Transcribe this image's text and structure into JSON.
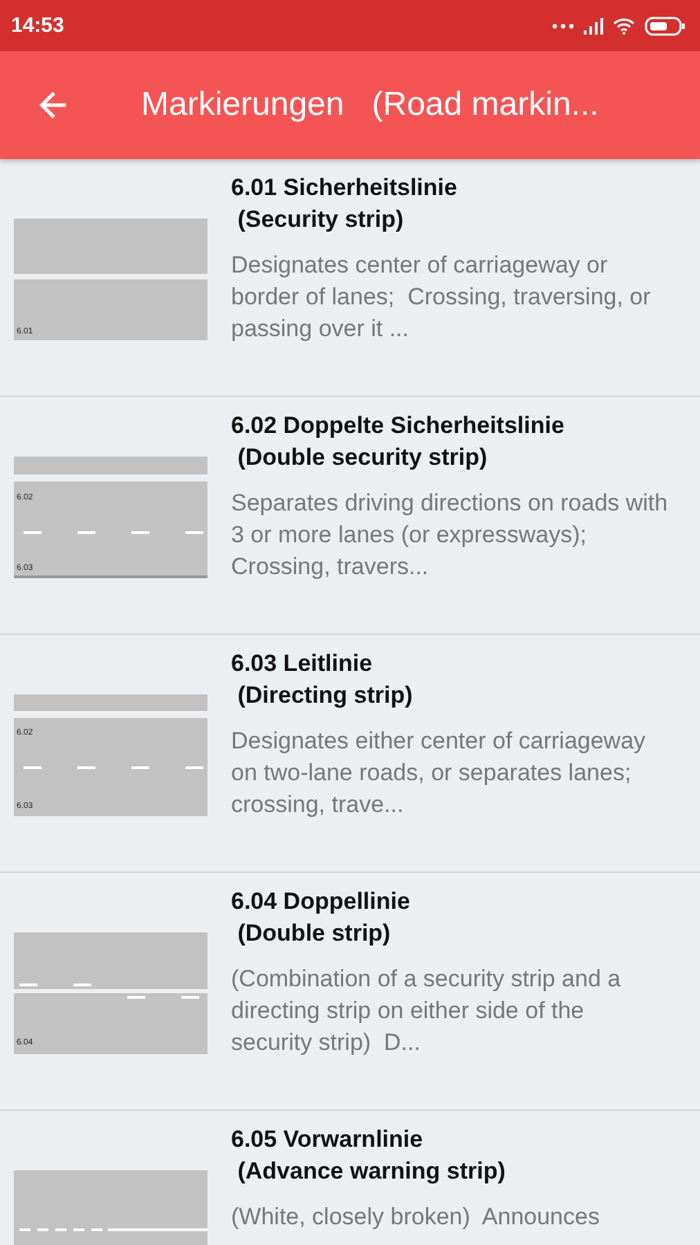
{
  "status_bar": {
    "time": "14:53"
  },
  "app_bar": {
    "title": "Markierungen   (Road markin..."
  },
  "items": [
    {
      "title": "6.01 Sicherheitslinie",
      "subtitle": "(Security strip)",
      "description": "Designates center of carriageway or border of lanes;  Crossing, traversing, or passing over it ...",
      "drawing": {
        "kind": "security",
        "labels": [
          "6.01"
        ]
      }
    },
    {
      "title": "6.02 Doppelte Sicherheitslinie",
      "subtitle": "(Double security strip)",
      "description": "Separates driving directions on roads with 3 or more lanes (or expressways);  Crossing, travers...",
      "drawing": {
        "kind": "double_security",
        "labels": [
          "6.02",
          "6.03"
        ]
      }
    },
    {
      "title": "6.03 Leitlinie",
      "subtitle": "(Directing strip)",
      "description": "Designates either center of carriageway on two-lane roads, or separates lanes;  crossing, trave...",
      "drawing": {
        "kind": "directing",
        "labels": [
          "6.02",
          "6.03"
        ]
      }
    },
    {
      "title": "6.04 Doppellinie",
      "subtitle": "(Double strip)",
      "description": "(Combination of a security strip and a directing strip on either side of the security strip)  D...",
      "drawing": {
        "kind": "double",
        "labels": [
          "6.04"
        ]
      }
    },
    {
      "title": "6.05 Vorwarnlinie",
      "subtitle": "(Advance warning strip)",
      "description": "(White, closely broken)  Announces",
      "drawing": {
        "kind": "advance_warning"
      }
    }
  ]
}
